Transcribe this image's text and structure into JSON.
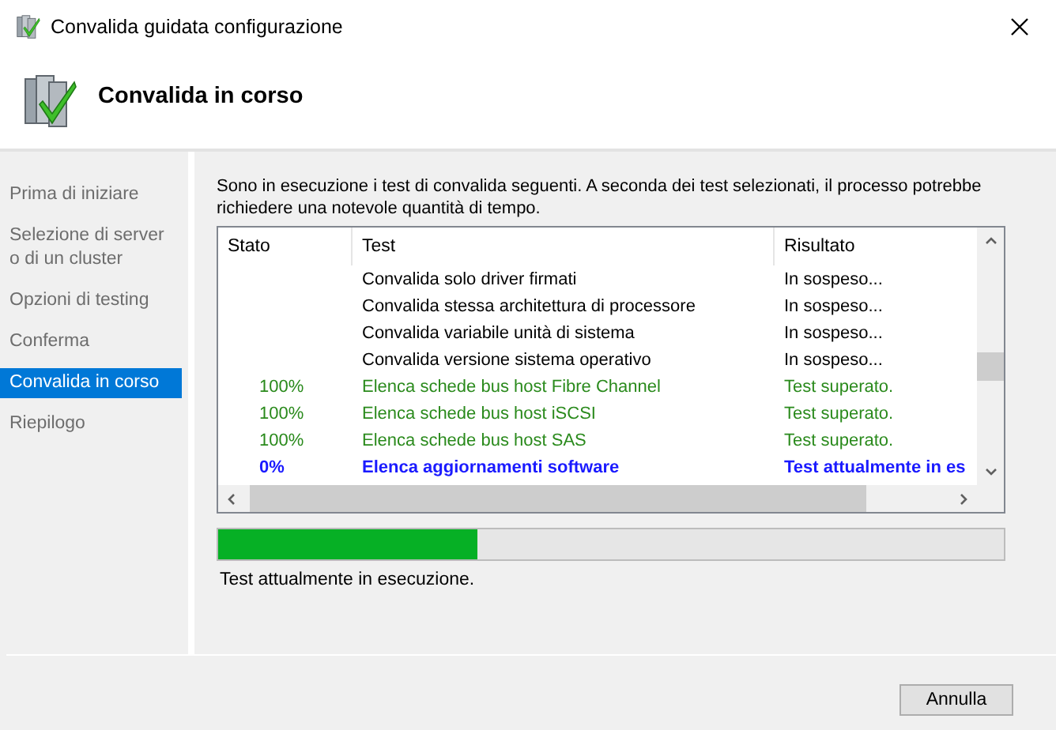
{
  "window": {
    "title": "Convalida guidata configurazione"
  },
  "header": {
    "title": "Convalida in corso"
  },
  "steps": [
    {
      "label": "Prima di iniziare",
      "selected": false
    },
    {
      "label": "Selezione di server o di un cluster",
      "selected": false
    },
    {
      "label": "Opzioni di testing",
      "selected": false
    },
    {
      "label": "Conferma",
      "selected": false
    },
    {
      "label": "Convalida in corso",
      "selected": true
    },
    {
      "label": "Riepilogo",
      "selected": false
    }
  ],
  "intro": "Sono in esecuzione i test di convalida seguenti. A seconda dei test selezionati, il processo potrebbe richiedere una notevole quantità di tempo.",
  "table": {
    "columns": [
      "Stato",
      "Test",
      "Risultato"
    ],
    "rows": [
      {
        "kind": "pending",
        "test": "Convalida solo driver firmati",
        "result": "In sospeso..."
      },
      {
        "kind": "pending",
        "test": "Convalida stessa architettura di processore",
        "result": "In sospeso..."
      },
      {
        "kind": "pending",
        "test": "Convalida variabile unità di sistema",
        "result": "In sospeso..."
      },
      {
        "kind": "pending",
        "test": "Convalida versione sistema operativo",
        "result": "In sospeso..."
      },
      {
        "kind": "passed",
        "status": "100%",
        "test": "Elenca schede bus host Fibre Channel",
        "result": "Test superato."
      },
      {
        "kind": "passed",
        "status": "100%",
        "test": "Elenca schede bus host iSCSI",
        "result": "Test superato."
      },
      {
        "kind": "passed",
        "status": "100%",
        "test": "Elenca schede bus host SAS",
        "result": "Test superato."
      },
      {
        "kind": "running",
        "status": "0%",
        "test": "Elenca aggiornamenti software",
        "result": "Test attualmente in es"
      }
    ]
  },
  "progress": {
    "level": 0.33
  },
  "status_text": "Test attualmente in esecuzione.",
  "buttons": [
    "Annulla"
  ]
}
